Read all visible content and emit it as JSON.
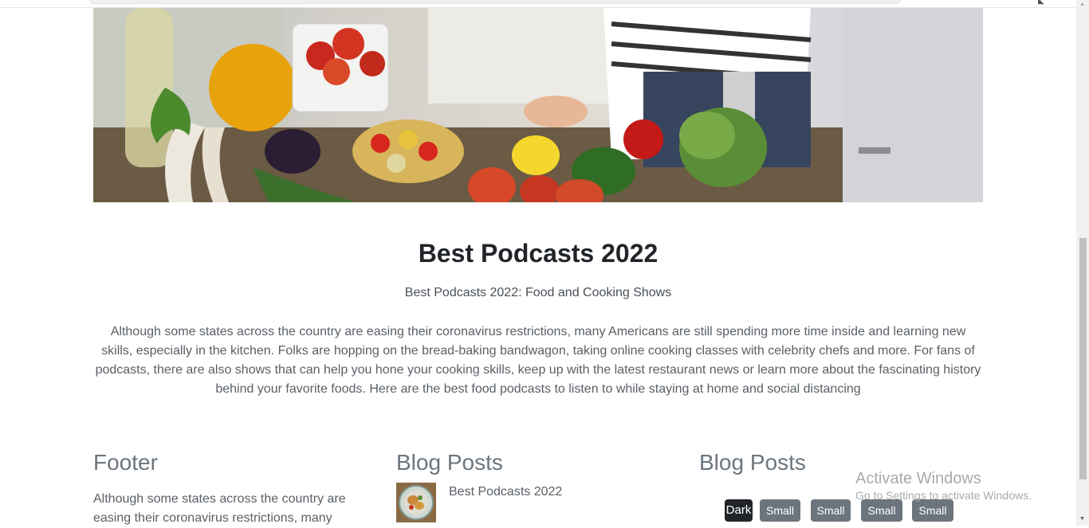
{
  "hero": {
    "image": "kitchen-vegetables-photo"
  },
  "article": {
    "title": "Best Podcasts 2022",
    "subtitle": "Best Podcasts 2022: Food and Cooking Shows",
    "body": "Although some states across the country are easing their coronavirus restrictions, many Americans are still spending more time inside and learning new skills, especially in the kitchen. Folks are hopping on the bread-baking bandwagon, taking online cooking classes with celebrity chefs and more. For fans of podcasts, there are also shows that can help you hone your cooking skills, keep up with the latest restaurant news or learn more about the fascinating history behind your favorite foods. Here are the best food podcasts to listen to while staying at home and social distancing"
  },
  "footer": {
    "heading": "Footer",
    "text": "Although some states across the country are easing their coronavirus restrictions, many"
  },
  "blog_posts_1": {
    "heading": "Blog Posts",
    "post_title": "Best Podcasts 2022"
  },
  "blog_posts_2": {
    "heading": "Blog Posts",
    "buttons": [
      "Dark",
      "Small",
      "Small",
      "Small",
      "Small"
    ]
  },
  "windows": {
    "line1": "Activate Windows",
    "line2": "Go to Settings to activate Windows."
  },
  "colors": {
    "dark": "#212529",
    "secondary": "#6c757d"
  }
}
